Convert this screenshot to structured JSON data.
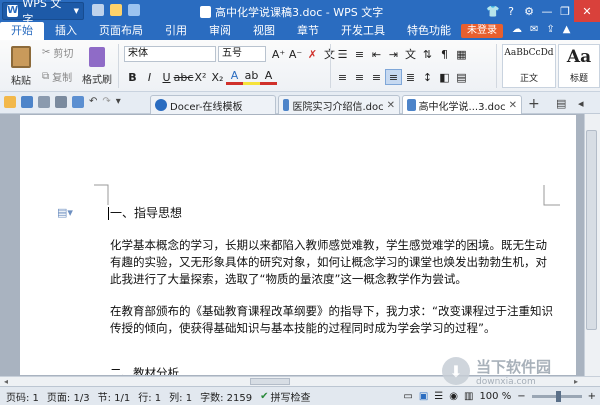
{
  "window": {
    "app_button": "WPS 文字",
    "title": "高中化学说课稿3.doc - WPS 文字",
    "login_label": "未登录"
  },
  "menu": [
    "开始",
    "插入",
    "页面布局",
    "引用",
    "审阅",
    "视图",
    "章节",
    "开发工具",
    "特色功能"
  ],
  "ribbon": {
    "paste": "粘贴",
    "cut": "剪切",
    "copy": "复制",
    "format_painter": "格式刷",
    "font_name": "宋体",
    "font_size": "五号",
    "style_normal_preview": "AaBbCcDd",
    "style_normal": "正文",
    "style_heading_preview": "Aa",
    "style_heading": "标题"
  },
  "tabs": [
    {
      "label": "Docer-在线模板"
    },
    {
      "label": "医院实习介绍信.doc"
    },
    {
      "label": "高中化学说...3.doc"
    }
  ],
  "document": {
    "heading": "一、指导思想",
    "p1": "化学基本概念的学习，长期以来都陷入教师感觉难教，学生感觉难学的困境。既无生动有趣的实验，又无形象具体的研究对象，如何让概念学习的课堂也焕发出勃勃生机，对此我进行了大量探索，选取了“物质的量浓度”这一概念教学作为尝试。",
    "p2": "在教育部颁布的《基础教育课程改革纲要》的指导下，我力求：“改变课程过于注重知识传授的倾向，使获得基础知识与基本技能的过程同时成为学会学习的过程”。",
    "p3": "二、教材分析"
  },
  "status": {
    "page_code": "页码: 1",
    "pages": "页面: 1/3",
    "section": "节: 1/1",
    "row": "行: 1",
    "col": "列: 1",
    "words": "字数: 2159",
    "spell": "拼写检查",
    "zoom": "100 %"
  },
  "watermark": {
    "name": "当下软件园",
    "url": "downxia.com"
  },
  "colors": {
    "accent": "#2a6cc0",
    "login": "#e85f2e"
  }
}
